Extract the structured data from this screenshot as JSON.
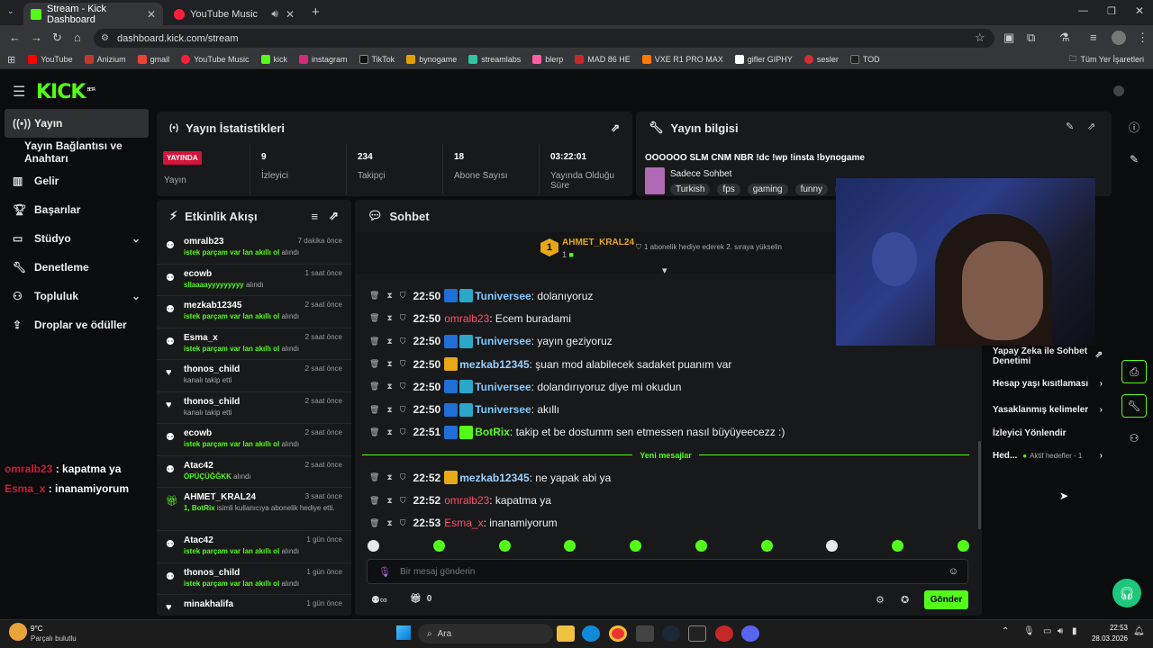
{
  "browser": {
    "tabs": [
      {
        "title": "Stream - Kick Dashboard",
        "close": "✕"
      },
      {
        "title": "YouTube Music",
        "close": "✕"
      }
    ],
    "new_tab": "+",
    "url": "dashboard.kick.com/stream",
    "bookmarks": [
      "YouTube",
      "Anizium",
      "gmail",
      "YouTube Music",
      "kick",
      "instagram",
      "TikTok",
      "bynogame",
      "streamlabs",
      "blerp",
      "MAD 86 HE",
      "VXE R1 PRO MAX",
      "gifler GIPHY",
      "sesler",
      "TOD"
    ],
    "bookmarks_folder": "Tüm Yer İşaretleri"
  },
  "brand": {
    "logo": "KICK",
    "beta": "BETA",
    "accent": "#53fc18"
  },
  "sidebar": [
    {
      "label": "Yayın",
      "icon": "broadcast-icon"
    },
    {
      "label": "Yayın Bağlantısı ve Anahtarı",
      "icon": ""
    },
    {
      "label": "Gelir",
      "icon": "revenue-icon"
    },
    {
      "label": "Başarılar",
      "icon": "trophy-icon"
    },
    {
      "label": "Stüdyo",
      "icon": "studio-icon"
    },
    {
      "label": "Denetleme",
      "icon": "wrench-icon"
    },
    {
      "label": "Topluluk",
      "icon": "community-icon"
    },
    {
      "label": "Droplar ve ödüller",
      "icon": "drops-icon"
    }
  ],
  "overlay_chat": [
    {
      "user": "omralb23",
      "text": " : kapatma ya"
    },
    {
      "user": "Esma_x",
      "text": " : inanamiyorum"
    }
  ],
  "stats": {
    "title": "Yayın İstatistikleri",
    "live_badge": "YAYINDA",
    "live_label": "Yayın",
    "items": [
      {
        "value": "9",
        "label": "İzleyici"
      },
      {
        "value": "234",
        "label": "Takipçi"
      },
      {
        "value": "18",
        "label": "Abone Sayısı"
      },
      {
        "value": "03:22:01",
        "label": "Yayında Olduğu Süre"
      }
    ]
  },
  "stream_info": {
    "title": "Yayın bilgisi",
    "stream_title": "OOOOOO SLM CNM NBR !dc !wp !insta !bynogame",
    "category": "Sadece Sohbet",
    "tags": [
      "Turkish",
      "fps",
      "gaming",
      "funny",
      "ga"
    ]
  },
  "activity": {
    "title": "Etkinlik Akışı",
    "items": [
      {
        "name": "omralb23",
        "desc": "istek parçam var lan akıllı ol",
        "suffix": " alındı",
        "time": "7 dakika önce",
        "icon": "drop-icon"
      },
      {
        "name": "ecowb",
        "desc": "sllaaaayyyyyyyyy",
        "suffix": " alındı",
        "time": "1 saat önce",
        "icon": "drop-icon"
      },
      {
        "name": "mezkab12345",
        "desc": "istek parçam var lan akıllı ol",
        "suffix": " alındı",
        "time": "2 saat önce",
        "icon": "drop-icon"
      },
      {
        "name": "Esma_x",
        "desc": "istek parçam var lan akıllı ol",
        "suffix": " alındı",
        "time": "2 saat önce",
        "icon": "drop-icon"
      },
      {
        "name": "thonos_child",
        "desc": "",
        "suffix": "kanalı takip etti",
        "time": "2 saat önce",
        "icon": "heart-icon"
      },
      {
        "name": "thonos_child",
        "desc": "",
        "suffix": "kanalı takip etti",
        "time": "2 saat önce",
        "icon": "heart-icon"
      },
      {
        "name": "ecowb",
        "desc": "istek parçam var lan akıllı ol",
        "suffix": " alındı",
        "time": "2 saat önce",
        "icon": "drop-icon"
      },
      {
        "name": "Atac42",
        "desc": "ÖPÜÇÜĞĞKK",
        "suffix": " alındı",
        "time": "2 saat önce",
        "icon": "drop-icon"
      },
      {
        "name": "AHMET_KRAL24",
        "desc": "1, BotRix",
        "suffix": " isimli kullanıcıya abonelik hediye etti.",
        "time": "3 saat önce",
        "icon": "gift-icon"
      },
      {
        "name": "Atac42",
        "desc": "istek parçam var lan akıllı ol",
        "suffix": " alındı",
        "time": "1 gün önce",
        "icon": "drop-icon"
      },
      {
        "name": "thonos_child",
        "desc": "istek parçam var lan akıllı ol",
        "suffix": " alındı",
        "time": "1 gün önce",
        "icon": "drop-icon"
      },
      {
        "name": "minakhalifa",
        "desc": "",
        "suffix": "",
        "time": "1 gün önce",
        "icon": "heart-icon"
      }
    ]
  },
  "chat": {
    "title": "Sohbet",
    "pinned_user": "AHMET_KRAL24",
    "pinned_rank": "1",
    "pinned_count": "1",
    "pinned_text": "1 abonelik hediye ederek 2. sıraya yükselin",
    "new_messages": "Yeni mesajlar",
    "messages": [
      {
        "time": "22:50",
        "user": "Tuniversee",
        "cls": "u1",
        "text": ": dolanıyoruz",
        "badges": [
          "#1f6fd6",
          "#2aa7c9"
        ]
      },
      {
        "time": "22:50",
        "user": "omralb23",
        "cls": "u2",
        "text": ": Ecem buradami",
        "badges": []
      },
      {
        "time": "22:50",
        "user": "Tuniversee",
        "cls": "u1",
        "text": ": yayın geziyoruz",
        "badges": [
          "#1f6fd6",
          "#2aa7c9"
        ]
      },
      {
        "time": "22:50",
        "user": "mezkab12345",
        "cls": "u3",
        "text": ": şuan mod alabilecek sadaket puanım var",
        "badges": [
          "#e6a817"
        ]
      },
      {
        "time": "22:50",
        "user": "Tuniversee",
        "cls": "u1",
        "text": ": dolandırıyoruz diye mi okudun",
        "badges": [
          "#1f6fd6",
          "#2aa7c9"
        ]
      },
      {
        "time": "22:50",
        "user": "Tuniversee",
        "cls": "u1",
        "text": ": akıllı",
        "badges": [
          "#1f6fd6",
          "#2aa7c9"
        ]
      },
      {
        "time": "22:51",
        "user": "BotRix",
        "cls": "u4",
        "text": ": takip et be dostumm sen etmessen nasıl büyüyeecezz :)",
        "badges": [
          "#1f6fd6",
          "#53fc18"
        ]
      },
      {
        "time": "22:52",
        "user": "mezkab12345",
        "cls": "u3",
        "text": ": ne yapak abi ya",
        "badges": [
          "#e6a817"
        ]
      },
      {
        "time": "22:52",
        "user": "omralb23",
        "cls": "u2",
        "text": ": kapatma ya",
        "badges": []
      },
      {
        "time": "22:53",
        "user": "Esma_x",
        "cls": "u2",
        "text": ": inanamiyorum",
        "badges": []
      }
    ],
    "input_placeholder": "Bir mesaj gönderin",
    "points": "0",
    "send_label": "Gönder"
  },
  "right_panel": {
    "items": [
      {
        "label": "Yapay Zeka ile Sohbet Denetimi",
        "arrow": "⇗"
      },
      {
        "label": "Hesap yaşı kısıtlaması",
        "arrow": "›"
      },
      {
        "label": "Yasaklanmış kelimeler",
        "arrow": "›"
      },
      {
        "label": "İzleyici Yönlendir",
        "arrow": ""
      }
    ],
    "goal_label": "Hed...",
    "goal_value": "Aktif hedefler - 1"
  },
  "taskbar": {
    "temp": "9°C",
    "weather": "Parçalı bulutlu",
    "search": "Ara",
    "time": "22:53",
    "date": "28.03.2026"
  }
}
